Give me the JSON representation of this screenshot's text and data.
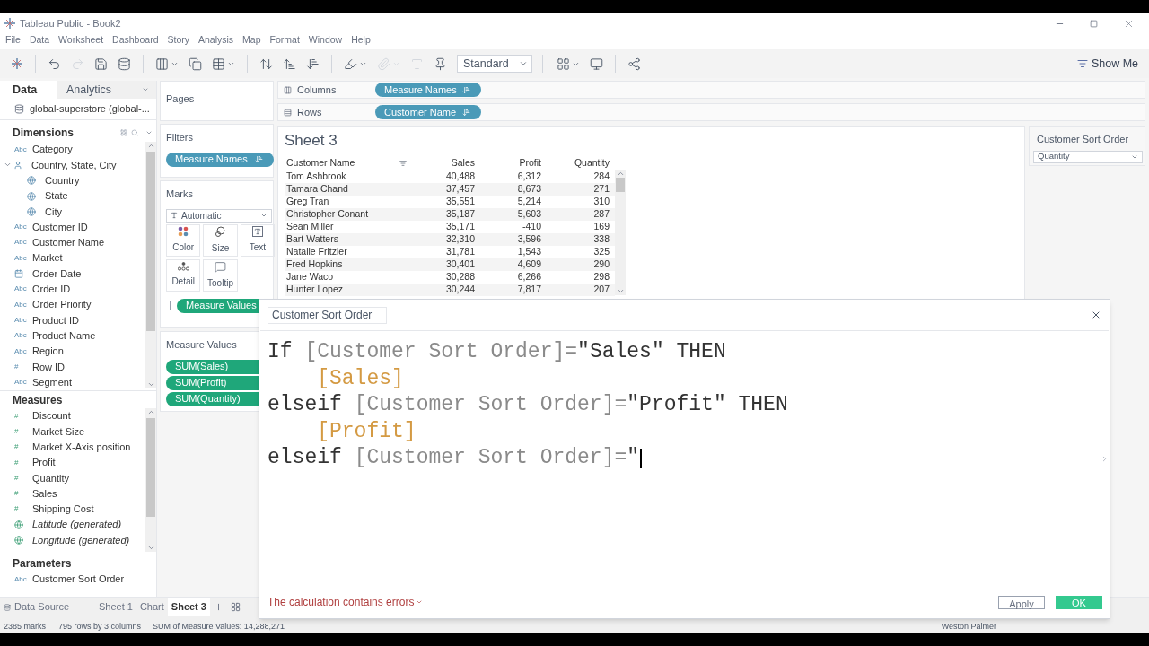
{
  "window": {
    "title": "Tableau Public - Book2"
  },
  "menu": [
    "File",
    "Data",
    "Worksheet",
    "Dashboard",
    "Story",
    "Analysis",
    "Map",
    "Format",
    "Window",
    "Help"
  ],
  "toolbar": {
    "fit": "Standard",
    "show_me": "Show Me"
  },
  "side_tabs": [
    {
      "label": "Data",
      "selected": true
    },
    {
      "label": "Analytics",
      "selected": false
    }
  ],
  "data_source": "global-superstore (global-...",
  "dimensions": {
    "title": "Dimensions",
    "fields": [
      {
        "name": "Category",
        "kind": "text",
        "glyph": "Abc"
      },
      {
        "name": "Country, State, City",
        "kind": "hierarchy",
        "expanded": true,
        "children": [
          {
            "name": "Country",
            "kind": "geo"
          },
          {
            "name": "State",
            "kind": "geo"
          },
          {
            "name": "City",
            "kind": "geo"
          }
        ]
      },
      {
        "name": "Customer ID",
        "kind": "text",
        "glyph": "Abc"
      },
      {
        "name": "Customer Name",
        "kind": "text",
        "glyph": "Abc"
      },
      {
        "name": "Market",
        "kind": "text",
        "glyph": "Abc"
      },
      {
        "name": "Order Date",
        "kind": "date"
      },
      {
        "name": "Order ID",
        "kind": "text",
        "glyph": "Abc"
      },
      {
        "name": "Order Priority",
        "kind": "text",
        "glyph": "Abc"
      },
      {
        "name": "Product ID",
        "kind": "text",
        "glyph": "Abc"
      },
      {
        "name": "Product Name",
        "kind": "text",
        "glyph": "Abc"
      },
      {
        "name": "Region",
        "kind": "text",
        "glyph": "Abc"
      },
      {
        "name": "Row ID",
        "kind": "text",
        "glyph": "#"
      },
      {
        "name": "Segment",
        "kind": "text",
        "glyph": "Abc"
      }
    ]
  },
  "measures": {
    "title": "Measures",
    "fields": [
      {
        "name": "Discount",
        "kind": "text",
        "glyph": "#",
        "generated": false
      },
      {
        "name": "Market Size",
        "kind": "text",
        "glyph": "#",
        "generated": false
      },
      {
        "name": "Market X-Axis position",
        "kind": "text",
        "glyph": "#",
        "generated": false
      },
      {
        "name": "Profit",
        "kind": "text",
        "glyph": "#",
        "generated": false
      },
      {
        "name": "Quantity",
        "kind": "text",
        "glyph": "#",
        "generated": false
      },
      {
        "name": "Sales",
        "kind": "text",
        "glyph": "#",
        "generated": false
      },
      {
        "name": "Shipping Cost",
        "kind": "text",
        "glyph": "#",
        "generated": false
      },
      {
        "name": "Latitude (generated)",
        "kind": "geo",
        "generated": true
      },
      {
        "name": "Longitude (generated)",
        "kind": "geo",
        "generated": true
      }
    ]
  },
  "parameters": {
    "title": "Parameters",
    "fields": [
      {
        "name": "Customer Sort Order",
        "kind": "text",
        "glyph": "Abc"
      }
    ]
  },
  "pages": {
    "title": "Pages"
  },
  "filters": {
    "title": "Filters",
    "pills": [
      "Measure Names"
    ]
  },
  "marks": {
    "title": "Marks",
    "type": "Automatic",
    "buttons": [
      {
        "label": "Color",
        "kind": "color"
      },
      {
        "label": "Size",
        "kind": "size"
      },
      {
        "label": "Text",
        "kind": "text"
      },
      {
        "label": "Detail",
        "kind": "detail"
      },
      {
        "label": "Tooltip",
        "kind": "tooltip"
      }
    ],
    "pill": "Measure Values"
  },
  "measure_values": {
    "title": "Measure Values",
    "pills": [
      "SUM(Sales)",
      "SUM(Profit)",
      "SUM(Quantity)"
    ]
  },
  "shelves": [
    {
      "label": "Columns",
      "kind": "columns",
      "pill": "Measure Names"
    },
    {
      "label": "Rows",
      "kind": "rows",
      "pill": "Customer Name"
    }
  ],
  "sheet": {
    "title": "Sheet 3",
    "table": {
      "columns": [
        "Customer Name",
        "Sales",
        "Profit",
        "Quantity"
      ],
      "rows": [
        [
          "Tom Ashbrook",
          "40,488",
          "6,312",
          "284"
        ],
        [
          "Tamara Chand",
          "37,457",
          "8,673",
          "271"
        ],
        [
          "Greg Tran",
          "35,551",
          "5,214",
          "310"
        ],
        [
          "Christopher Conant",
          "35,187",
          "5,603",
          "287"
        ],
        [
          "Sean Miller",
          "35,171",
          "-410",
          "169"
        ],
        [
          "Bart Watters",
          "32,310",
          "3,596",
          "338"
        ],
        [
          "Natalie Fritzler",
          "31,781",
          "1,543",
          "325"
        ],
        [
          "Fred Hopkins",
          "30,401",
          "4,609",
          "290"
        ],
        [
          "Jane Waco",
          "30,288",
          "6,266",
          "298"
        ],
        [
          "Hunter Lopez",
          "30,244",
          "7,817",
          "207"
        ]
      ]
    }
  },
  "parameter_card": {
    "title": "Customer Sort Order",
    "value": "Quantity"
  },
  "sheet_tabs": [
    {
      "label": "Data Source",
      "kind": "source",
      "selected": false
    },
    {
      "label": "Sheet 1",
      "kind": "sheet",
      "selected": false
    },
    {
      "label": "Chart",
      "kind": "sheet",
      "selected": false
    },
    {
      "label": "Sheet 3",
      "kind": "sheet",
      "selected": true
    }
  ],
  "status_bar": {
    "marks": "2385 marks",
    "size": "795 rows by 3 columns",
    "sum": "SUM of Measure Values: 14,288,271",
    "user": "Weston Palmer"
  },
  "dialog": {
    "name": "Customer Sort Order",
    "lines": [
      {
        "indent": false,
        "tokens": [
          {
            "kind": "keyword",
            "text": "If "
          },
          {
            "kind": "param",
            "text": "[Customer Sort Order]="
          },
          {
            "kind": "string",
            "text": "\"Sales\""
          },
          {
            "kind": "keyword",
            "text": " THEN"
          }
        ]
      },
      {
        "indent": true,
        "tokens": [
          {
            "kind": "field",
            "text": "[Sales]"
          }
        ]
      },
      {
        "indent": false,
        "tokens": [
          {
            "kind": "keyword",
            "text": "elseif "
          },
          {
            "kind": "param",
            "text": "[Customer Sort Order]="
          },
          {
            "kind": "string",
            "text": "\"Profit\""
          },
          {
            "kind": "keyword",
            "text": " THEN"
          }
        ]
      },
      {
        "indent": true,
        "tokens": [
          {
            "kind": "field",
            "text": "[Profit]"
          }
        ]
      },
      {
        "indent": false,
        "tokens": [
          {
            "kind": "keyword",
            "text": "elseif "
          },
          {
            "kind": "param",
            "text": "[Customer Sort Order]="
          },
          {
            "kind": "string",
            "text": "\""
          }
        ]
      }
    ],
    "error": "The calculation contains errors",
    "buttons": [
      {
        "label": "Apply",
        "kind": "secondary"
      },
      {
        "label": "OK",
        "kind": "primary"
      }
    ]
  }
}
